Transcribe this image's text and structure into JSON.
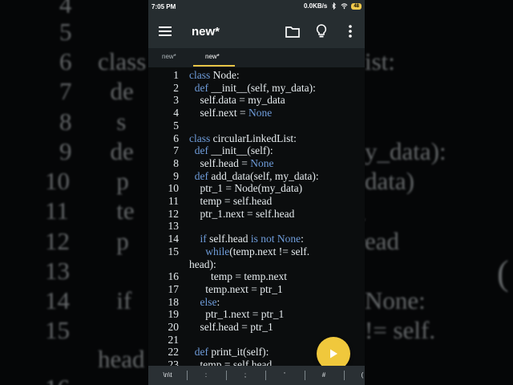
{
  "status_bar": {
    "time": "7:05 PM",
    "net_speed": "0.0KB/s",
    "battery": "48"
  },
  "app_bar": {
    "title": "new*",
    "icons": [
      "menu-icon",
      "folder-icon",
      "lightbulb-icon",
      "more-vert-icon"
    ]
  },
  "tabs": [
    {
      "label": "new*",
      "active": false
    },
    {
      "label": "new*",
      "active": true
    }
  ],
  "editor": {
    "lines": [
      {
        "n": "1",
        "tokens": [
          [
            "kw",
            "class"
          ],
          [
            "t",
            " Node:"
          ]
        ]
      },
      {
        "n": "2",
        "tokens": [
          [
            "t",
            "  "
          ],
          [
            "kw",
            "def"
          ],
          [
            "t",
            " __init__(self, my_data):"
          ]
        ]
      },
      {
        "n": "3",
        "tokens": [
          [
            "t",
            "    self.data = my_data"
          ]
        ]
      },
      {
        "n": "4",
        "tokens": [
          [
            "t",
            "    self.next = "
          ],
          [
            "kw",
            "None"
          ]
        ]
      },
      {
        "n": "5",
        "tokens": []
      },
      {
        "n": "6",
        "tokens": [
          [
            "kw",
            "class"
          ],
          [
            "t",
            " circularLinkedList:"
          ]
        ]
      },
      {
        "n": "7",
        "tokens": [
          [
            "t",
            "  "
          ],
          [
            "kw",
            "def"
          ],
          [
            "t",
            " __init__(self):"
          ]
        ]
      },
      {
        "n": "8",
        "tokens": [
          [
            "t",
            "    self.head = "
          ],
          [
            "kw",
            "None"
          ]
        ]
      },
      {
        "n": "9",
        "tokens": [
          [
            "t",
            "  "
          ],
          [
            "kw",
            "def"
          ],
          [
            "t",
            " add_data(self, my_data):"
          ]
        ]
      },
      {
        "n": "10",
        "tokens": [
          [
            "t",
            "    ptr_1 = Node(my_data)"
          ]
        ]
      },
      {
        "n": "11",
        "tokens": [
          [
            "t",
            "    temp = self.head"
          ]
        ]
      },
      {
        "n": "12",
        "tokens": [
          [
            "t",
            "    ptr_1.next = self.head"
          ]
        ]
      },
      {
        "n": "13",
        "tokens": []
      },
      {
        "n": "14",
        "tokens": [
          [
            "t",
            "    "
          ],
          [
            "kw",
            "if"
          ],
          [
            "t",
            " self.head "
          ],
          [
            "kw",
            "is not None"
          ],
          [
            "t",
            ":"
          ]
        ]
      },
      {
        "n": "15",
        "tokens": [
          [
            "t",
            "      "
          ],
          [
            "kw",
            "while"
          ],
          [
            "t",
            "(temp.next != self."
          ]
        ]
      },
      {
        "n": "",
        "tokens": [
          [
            "t",
            "head):"
          ]
        ]
      },
      {
        "n": "16",
        "tokens": [
          [
            "t",
            "        temp = temp.next"
          ]
        ]
      },
      {
        "n": "17",
        "tokens": [
          [
            "t",
            "      temp.next = ptr_1"
          ]
        ]
      },
      {
        "n": "18",
        "tokens": [
          [
            "t",
            "    "
          ],
          [
            "kw",
            "else"
          ],
          [
            "t",
            ":"
          ]
        ]
      },
      {
        "n": "19",
        "tokens": [
          [
            "t",
            "      ptr_1.next = ptr_1"
          ]
        ]
      },
      {
        "n": "20",
        "tokens": [
          [
            "t",
            "    self.head = ptr_1"
          ]
        ]
      },
      {
        "n": "21",
        "tokens": []
      },
      {
        "n": "22",
        "tokens": [
          [
            "t",
            "  "
          ],
          [
            "kw",
            "def"
          ],
          [
            "t",
            " print_it(self):"
          ]
        ]
      },
      {
        "n": "23",
        "tokens": [
          [
            "t",
            "    temp = self.head"
          ]
        ]
      }
    ]
  },
  "fab": {
    "icon": "play-icon"
  },
  "key_bar": {
    "keys": [
      "\\n\\t",
      ":",
      ";",
      "'",
      "#",
      "("
    ]
  },
  "background": {
    "lines": [
      {
        "n": "4",
        "code": ""
      },
      {
        "n": "5",
        "code": ""
      },
      {
        "n": "6",
        "code": "class"
      },
      {
        "n": "7",
        "code": "  de"
      },
      {
        "n": "8",
        "code": "   s"
      },
      {
        "n": "9",
        "code": "  de"
      },
      {
        "n": "10",
        "code": "   p"
      },
      {
        "n": "11",
        "code": "   te"
      },
      {
        "n": "12",
        "code": "   p"
      },
      {
        "n": "13",
        "code": ""
      },
      {
        "n": "14",
        "code": "   if"
      },
      {
        "n": "15",
        "code": ""
      },
      {
        "n": "",
        "code": "head"
      },
      {
        "n": "16",
        "code": ""
      }
    ],
    "right_fragments": [
      "ist:",
      "y_data):",
      "data)",
      "(",
      "ead",
      "(",
      "None:",
      "!= self."
    ]
  },
  "colors": {
    "keyword": "#6f9ddb",
    "text": "#e6ecef",
    "editor_bg": "#0b0d0e",
    "toolbar_bg": "#262d30",
    "accent": "#f0c83c"
  }
}
